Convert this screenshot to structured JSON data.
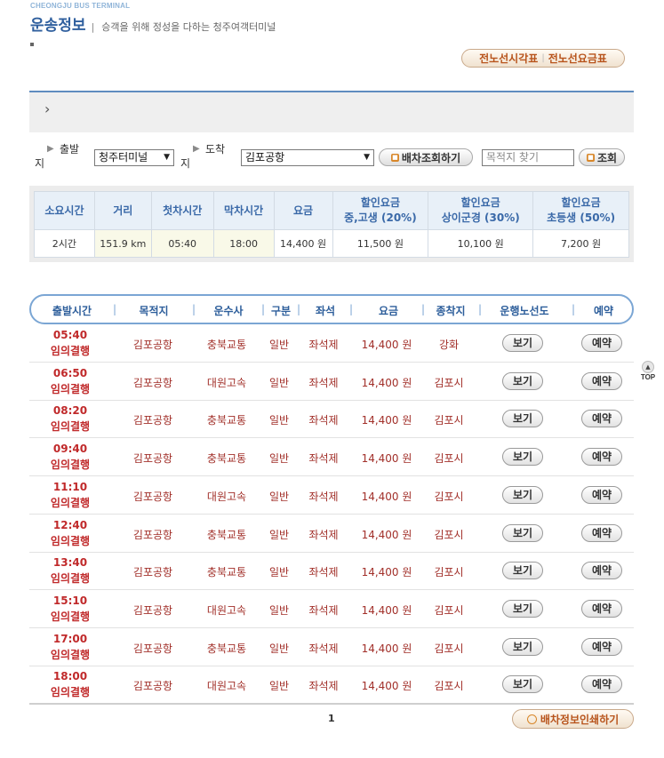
{
  "header": {
    "brand_en": "CHEONGJU BUS TERMINAL",
    "title": "운송정보",
    "separator": "|",
    "subtitle": "승객을 위해 정성을 다하는 청주여객터미널"
  },
  "top_buttons": {
    "timetable_label": "전노선시각표",
    "divider": "|",
    "fare_label": "전노선요금표"
  },
  "breadcrumb_icon": "›",
  "search": {
    "departure_label": "출발지",
    "departure_value": "청주터미널",
    "arrival_label": "도착지",
    "arrival_value": "김포공항",
    "dispatch_button": "배차조회하기",
    "destination_placeholder": "목적지 찾기",
    "lookup_button": "조회"
  },
  "summary": {
    "headers": [
      "소요시간",
      "거리",
      "첫차시간",
      "막차시간",
      "요금",
      "할인요금\n중,고생 (20%)",
      "할인요금\n상이군경 (30%)",
      "할인요금\n초등생 (50%)"
    ],
    "header_lines": [
      [
        "소요시간"
      ],
      [
        "거리"
      ],
      [
        "첫차시간"
      ],
      [
        "막차시간"
      ],
      [
        "요금"
      ],
      [
        "할인요금",
        "중,고생 (20%)"
      ],
      [
        "할인요금",
        "상이군경 (30%)"
      ],
      [
        "할인요금",
        "초등생 (50%)"
      ]
    ],
    "values": [
      "2시간",
      "151.9 km",
      "05:40",
      "18:00",
      "14,400 원",
      "11,500 원",
      "10,100 원",
      "7,200 원"
    ]
  },
  "list": {
    "columns": [
      "출발시간",
      "목적지",
      "운수사",
      "구분",
      "좌석",
      "요금",
      "종착지",
      "운행노선도",
      "예약"
    ],
    "view_label": "보기",
    "reserve_label": "예약",
    "rows": [
      {
        "time": "05:40",
        "note": "임의결행",
        "dest": "김포공항",
        "company": "충북교통",
        "type": "일반",
        "seat": "좌석제",
        "fare": "14,400 원",
        "terminal": "강화"
      },
      {
        "time": "06:50",
        "note": "임의결행",
        "dest": "김포공항",
        "company": "대원고속",
        "type": "일반",
        "seat": "좌석제",
        "fare": "14,400 원",
        "terminal": "김포시"
      },
      {
        "time": "08:20",
        "note": "임의결행",
        "dest": "김포공항",
        "company": "충북교통",
        "type": "일반",
        "seat": "좌석제",
        "fare": "14,400 원",
        "terminal": "김포시"
      },
      {
        "time": "09:40",
        "note": "임의결행",
        "dest": "김포공항",
        "company": "충북교통",
        "type": "일반",
        "seat": "좌석제",
        "fare": "14,400 원",
        "terminal": "김포시"
      },
      {
        "time": "11:10",
        "note": "임의결행",
        "dest": "김포공항",
        "company": "대원고속",
        "type": "일반",
        "seat": "좌석제",
        "fare": "14,400 원",
        "terminal": "김포시"
      },
      {
        "time": "12:40",
        "note": "임의결행",
        "dest": "김포공항",
        "company": "충북교통",
        "type": "일반",
        "seat": "좌석제",
        "fare": "14,400 원",
        "terminal": "김포시"
      },
      {
        "time": "13:40",
        "note": "임의결행",
        "dest": "김포공항",
        "company": "충북교통",
        "type": "일반",
        "seat": "좌석제",
        "fare": "14,400 원",
        "terminal": "김포시"
      },
      {
        "time": "15:10",
        "note": "임의결행",
        "dest": "김포공항",
        "company": "대원고속",
        "type": "일반",
        "seat": "좌석제",
        "fare": "14,400 원",
        "terminal": "김포시"
      },
      {
        "time": "17:00",
        "note": "임의결행",
        "dest": "김포공항",
        "company": "충북교통",
        "type": "일반",
        "seat": "좌석제",
        "fare": "14,400 원",
        "terminal": "김포시"
      },
      {
        "time": "18:00",
        "note": "임의결행",
        "dest": "김포공항",
        "company": "대원고속",
        "type": "일반",
        "seat": "좌석제",
        "fare": "14,400 원",
        "terminal": "김포시"
      }
    ]
  },
  "pagination": {
    "current": "1"
  },
  "print_button": "배차정보인쇄하기",
  "top_link": "TOP",
  "colors": {
    "accent": "#2f5f9e",
    "time_red": "#c0292a",
    "row_text": "#a2302a",
    "orange": "#b8541c"
  }
}
